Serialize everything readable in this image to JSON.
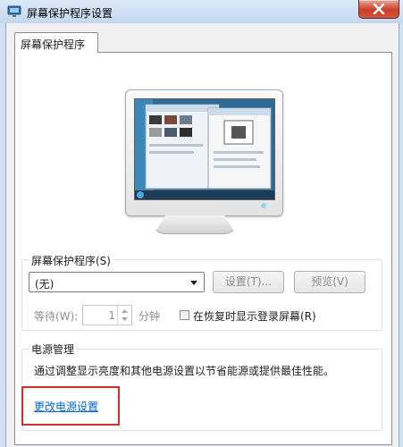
{
  "window": {
    "title": "屏幕保护程序设置"
  },
  "tabs": [
    {
      "label": "屏幕保护程序",
      "selected": true
    }
  ],
  "screensaver": {
    "group_label": "屏幕保护程序(S)",
    "selected_value": "(无)",
    "settings_button": "设置(T)...",
    "preview_button": "预览(V)",
    "wait_label": "等待(W):",
    "wait_value": "1",
    "wait_unit": "分钟",
    "resume_checkbox_label": "在恢复时显示登录屏幕(R)",
    "resume_checked": false
  },
  "power": {
    "group_label": "电源管理",
    "description": "通过调整显示亮度和其他电源设置以节省能源或提供最佳性能。",
    "link_label": "更改电源设置"
  },
  "colors": {
    "title_bar": "#c4d8ee",
    "link": "#0066cc",
    "highlight_box": "#d32f2f"
  },
  "icons": [
    "app-monitor-icon",
    "close-icon",
    "chevron-down-icon"
  ]
}
